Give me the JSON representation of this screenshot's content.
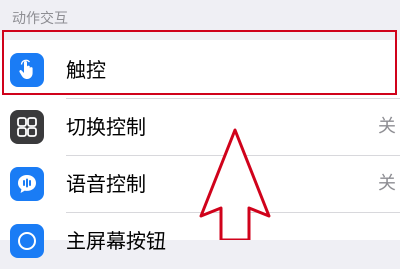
{
  "section": {
    "title": "动作交互"
  },
  "rows": [
    {
      "label": "触控",
      "value": "",
      "icon": "hand-touch-icon",
      "icon_color": "#1a7cf5"
    },
    {
      "label": "切换控制",
      "value": "关",
      "icon": "switch-control-icon",
      "icon_color": "#3a3a3c"
    },
    {
      "label": "语音控制",
      "value": "关",
      "icon": "voice-control-icon",
      "icon_color": "#1a7cf5"
    },
    {
      "label": "主屏幕按钮",
      "value": "",
      "icon": "home-button-icon",
      "icon_color": "#1a7cf5"
    }
  ],
  "annotation": {
    "highlight_color": "#d0021b"
  }
}
